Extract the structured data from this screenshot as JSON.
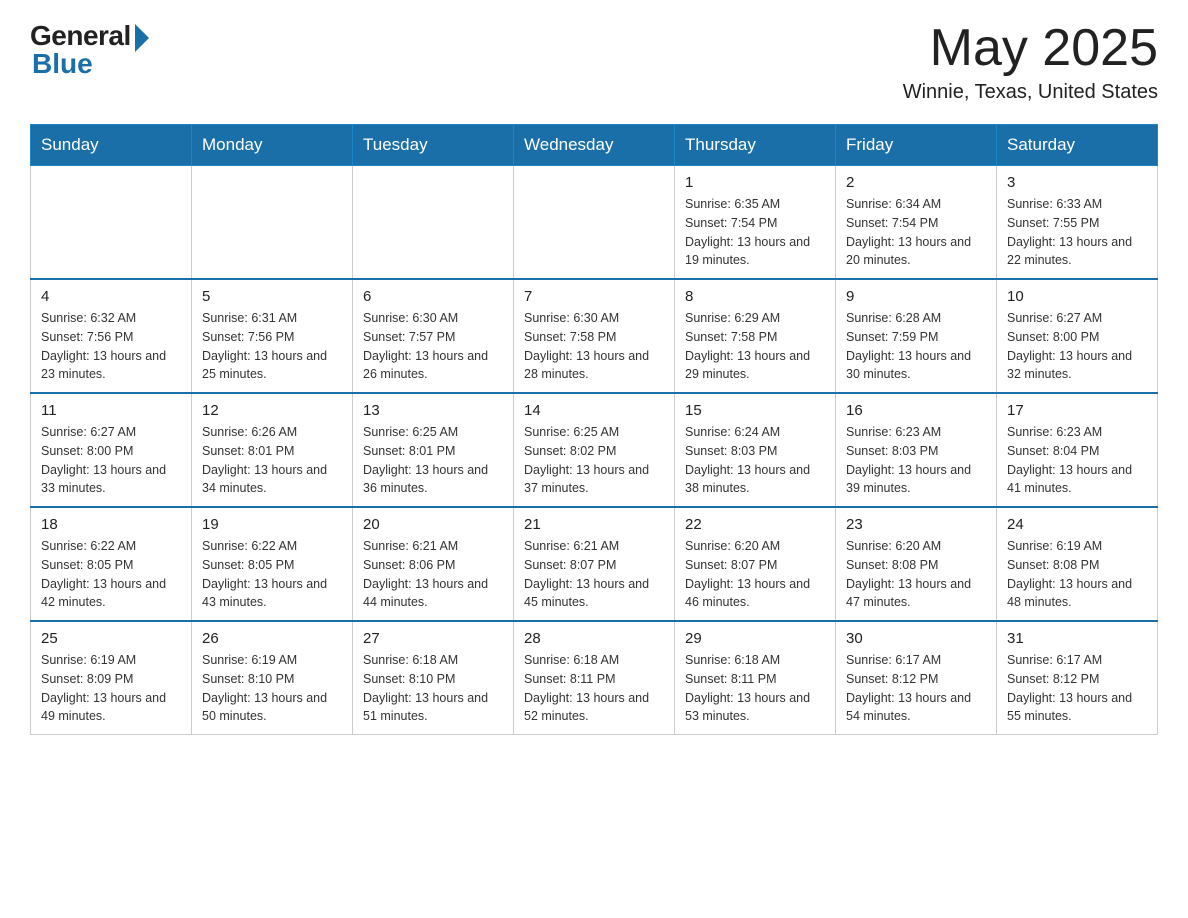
{
  "header": {
    "logo_general": "General",
    "logo_blue": "Blue",
    "month_title": "May 2025",
    "location": "Winnie, Texas, United States"
  },
  "days_of_week": [
    "Sunday",
    "Monday",
    "Tuesday",
    "Wednesday",
    "Thursday",
    "Friday",
    "Saturday"
  ],
  "weeks": [
    [
      {
        "day": "",
        "info": ""
      },
      {
        "day": "",
        "info": ""
      },
      {
        "day": "",
        "info": ""
      },
      {
        "day": "",
        "info": ""
      },
      {
        "day": "1",
        "info": "Sunrise: 6:35 AM\nSunset: 7:54 PM\nDaylight: 13 hours\nand 19 minutes."
      },
      {
        "day": "2",
        "info": "Sunrise: 6:34 AM\nSunset: 7:54 PM\nDaylight: 13 hours\nand 20 minutes."
      },
      {
        "day": "3",
        "info": "Sunrise: 6:33 AM\nSunset: 7:55 PM\nDaylight: 13 hours\nand 22 minutes."
      }
    ],
    [
      {
        "day": "4",
        "info": "Sunrise: 6:32 AM\nSunset: 7:56 PM\nDaylight: 13 hours\nand 23 minutes."
      },
      {
        "day": "5",
        "info": "Sunrise: 6:31 AM\nSunset: 7:56 PM\nDaylight: 13 hours\nand 25 minutes."
      },
      {
        "day": "6",
        "info": "Sunrise: 6:30 AM\nSunset: 7:57 PM\nDaylight: 13 hours\nand 26 minutes."
      },
      {
        "day": "7",
        "info": "Sunrise: 6:30 AM\nSunset: 7:58 PM\nDaylight: 13 hours\nand 28 minutes."
      },
      {
        "day": "8",
        "info": "Sunrise: 6:29 AM\nSunset: 7:58 PM\nDaylight: 13 hours\nand 29 minutes."
      },
      {
        "day": "9",
        "info": "Sunrise: 6:28 AM\nSunset: 7:59 PM\nDaylight: 13 hours\nand 30 minutes."
      },
      {
        "day": "10",
        "info": "Sunrise: 6:27 AM\nSunset: 8:00 PM\nDaylight: 13 hours\nand 32 minutes."
      }
    ],
    [
      {
        "day": "11",
        "info": "Sunrise: 6:27 AM\nSunset: 8:00 PM\nDaylight: 13 hours\nand 33 minutes."
      },
      {
        "day": "12",
        "info": "Sunrise: 6:26 AM\nSunset: 8:01 PM\nDaylight: 13 hours\nand 34 minutes."
      },
      {
        "day": "13",
        "info": "Sunrise: 6:25 AM\nSunset: 8:01 PM\nDaylight: 13 hours\nand 36 minutes."
      },
      {
        "day": "14",
        "info": "Sunrise: 6:25 AM\nSunset: 8:02 PM\nDaylight: 13 hours\nand 37 minutes."
      },
      {
        "day": "15",
        "info": "Sunrise: 6:24 AM\nSunset: 8:03 PM\nDaylight: 13 hours\nand 38 minutes."
      },
      {
        "day": "16",
        "info": "Sunrise: 6:23 AM\nSunset: 8:03 PM\nDaylight: 13 hours\nand 39 minutes."
      },
      {
        "day": "17",
        "info": "Sunrise: 6:23 AM\nSunset: 8:04 PM\nDaylight: 13 hours\nand 41 minutes."
      }
    ],
    [
      {
        "day": "18",
        "info": "Sunrise: 6:22 AM\nSunset: 8:05 PM\nDaylight: 13 hours\nand 42 minutes."
      },
      {
        "day": "19",
        "info": "Sunrise: 6:22 AM\nSunset: 8:05 PM\nDaylight: 13 hours\nand 43 minutes."
      },
      {
        "day": "20",
        "info": "Sunrise: 6:21 AM\nSunset: 8:06 PM\nDaylight: 13 hours\nand 44 minutes."
      },
      {
        "day": "21",
        "info": "Sunrise: 6:21 AM\nSunset: 8:07 PM\nDaylight: 13 hours\nand 45 minutes."
      },
      {
        "day": "22",
        "info": "Sunrise: 6:20 AM\nSunset: 8:07 PM\nDaylight: 13 hours\nand 46 minutes."
      },
      {
        "day": "23",
        "info": "Sunrise: 6:20 AM\nSunset: 8:08 PM\nDaylight: 13 hours\nand 47 minutes."
      },
      {
        "day": "24",
        "info": "Sunrise: 6:19 AM\nSunset: 8:08 PM\nDaylight: 13 hours\nand 48 minutes."
      }
    ],
    [
      {
        "day": "25",
        "info": "Sunrise: 6:19 AM\nSunset: 8:09 PM\nDaylight: 13 hours\nand 49 minutes."
      },
      {
        "day": "26",
        "info": "Sunrise: 6:19 AM\nSunset: 8:10 PM\nDaylight: 13 hours\nand 50 minutes."
      },
      {
        "day": "27",
        "info": "Sunrise: 6:18 AM\nSunset: 8:10 PM\nDaylight: 13 hours\nand 51 minutes."
      },
      {
        "day": "28",
        "info": "Sunrise: 6:18 AM\nSunset: 8:11 PM\nDaylight: 13 hours\nand 52 minutes."
      },
      {
        "day": "29",
        "info": "Sunrise: 6:18 AM\nSunset: 8:11 PM\nDaylight: 13 hours\nand 53 minutes."
      },
      {
        "day": "30",
        "info": "Sunrise: 6:17 AM\nSunset: 8:12 PM\nDaylight: 13 hours\nand 54 minutes."
      },
      {
        "day": "31",
        "info": "Sunrise: 6:17 AM\nSunset: 8:12 PM\nDaylight: 13 hours\nand 55 minutes."
      }
    ]
  ]
}
